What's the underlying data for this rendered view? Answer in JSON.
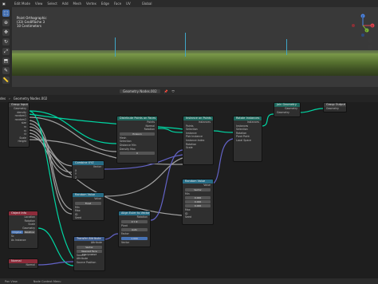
{
  "topbar": {
    "mode": "Edit Mode",
    "menus": [
      "View",
      "Select",
      "Add",
      "Mesh",
      "Vertex",
      "Edge",
      "Face",
      "UV"
    ],
    "orientation": "Global"
  },
  "viewport": {
    "line1": "Point Orthographic",
    "line2": "(33) Großfläche 3",
    "line3": "10 Centimeters",
    "gizmo_axes": [
      "X",
      "Y",
      "Z"
    ]
  },
  "node_editor": {
    "header_label": "Geometry Nodes.002",
    "breadcrumb": [
      "des",
      "Geometry Nodes.002"
    ]
  },
  "nodes": {
    "group_input": {
      "title": "Group Input",
      "rows": [
        "Geometry",
        "density",
        "random1",
        "random2",
        "size",
        "rx",
        "ry",
        "rz",
        "Scale",
        "Height"
      ]
    },
    "distribute": {
      "title": "Distribute Points on Faces",
      "rows": [
        "Points",
        "Normal",
        "Rotation",
        "Poisson",
        "Mesh",
        "Selection",
        "Distance Min",
        "Density Max",
        "Seed"
      ],
      "seed": "0"
    },
    "instance": {
      "title": "Instance on Points",
      "rows": [
        "Instances",
        "Points",
        "Selection",
        "Instance",
        "Pick Instance",
        "Instance Index",
        "Rotation",
        "Scale"
      ]
    },
    "rotate": {
      "title": "Rotate Instances",
      "rows": [
        "Instances",
        "Instances",
        "Selection",
        "Rotation",
        "Pivot Point",
        "Local Space"
      ]
    },
    "realize": {
      "title": "Join Geometry",
      "rows": [
        "Geometry",
        "Geometry"
      ]
    },
    "group_output": {
      "title": "Group Output",
      "rows": [
        "Geometry"
      ]
    },
    "combine": {
      "title": "Combine XYZ",
      "rows": [
        "Vector",
        "X",
        "Y",
        "Z"
      ]
    },
    "random_value": {
      "title": "Random Value",
      "rows": [
        "Value",
        "Float",
        "Min",
        "Max",
        "ID",
        "Seed"
      ]
    },
    "random_vec": {
      "title": "Random Value",
      "rows": [
        "Value",
        "Vector",
        "Min",
        "Max",
        "ID",
        "Seed"
      ],
      "values": [
        "0.000",
        "0.000",
        "0.000"
      ]
    },
    "object_info": {
      "title": "Object Info",
      "rows": [
        "Location",
        "Rotation",
        "Scale",
        "Geometry",
        "Original",
        "Relative",
        "Sc",
        "As Instance"
      ]
    },
    "align": {
      "title": "Align Euler to Vector",
      "rows": [
        "Rotation",
        "X Y Z",
        "Pivot",
        "Auto",
        "Factor",
        "Vector"
      ],
      "factor": "1.000"
    },
    "transfer": {
      "title": "Transfer Attribute",
      "rows": [
        "Attribute",
        "Vector",
        "Nearest Face Interpolated",
        "Source",
        "Attribute",
        "Source Position"
      ]
    },
    "normal": {
      "title": "Normal",
      "rows": [
        "Normal"
      ]
    }
  },
  "statusbar": {
    "items": [
      "Pan View",
      "Node Context Menu"
    ]
  },
  "colors": {
    "geometry_socket": "#00d6a3",
    "float_socket": "#a1a1a1",
    "vector_socket": "#6363c7",
    "accent": "#4772b3"
  }
}
